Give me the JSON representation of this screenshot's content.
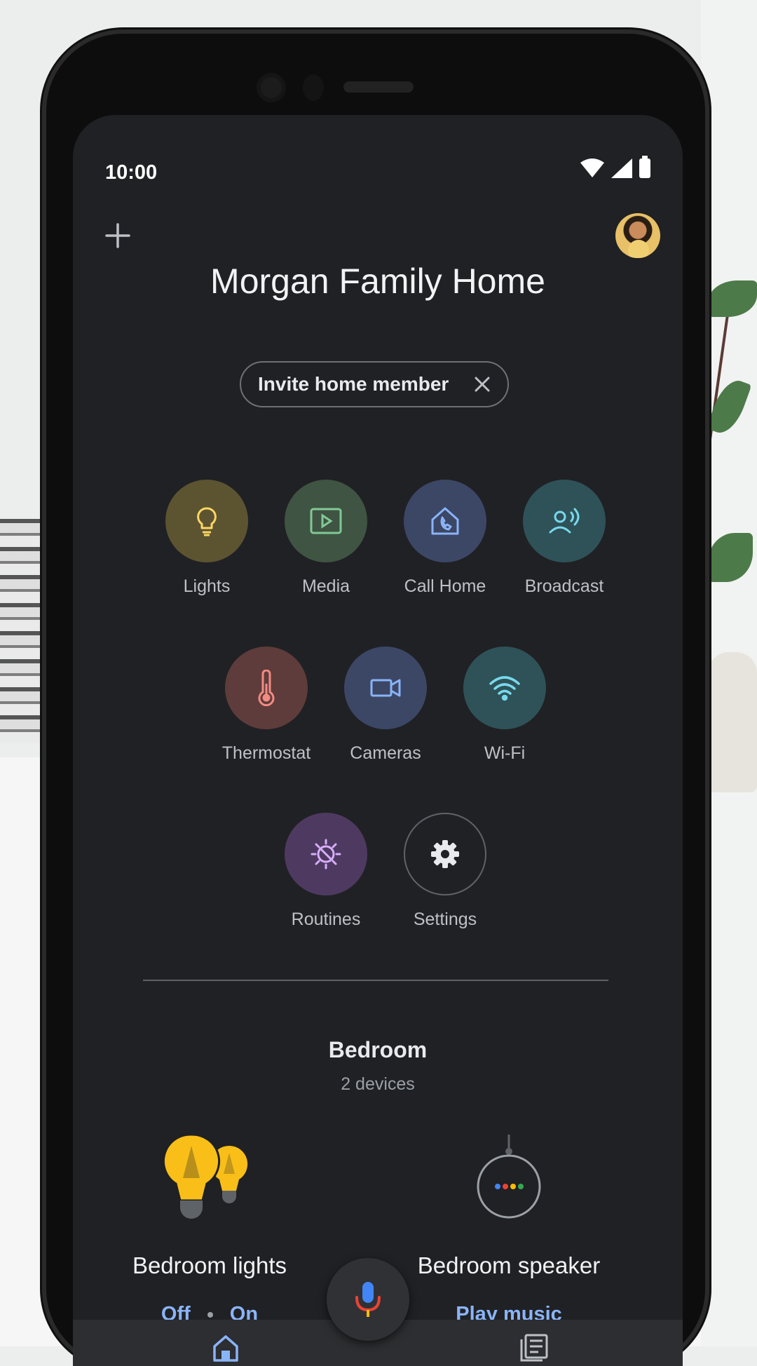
{
  "status_bar": {
    "time": "10:00"
  },
  "header": {
    "home_name": "Morgan Family Home",
    "invite_chip": "Invite home member"
  },
  "shortcuts": [
    {
      "label": "Lights",
      "icon": "lightbulb-icon",
      "color": "#5c5431"
    },
    {
      "label": "Media",
      "icon": "media-icon",
      "color": "#3f5442"
    },
    {
      "label": "Call Home",
      "icon": "call-home-icon",
      "color": "#3c4766"
    },
    {
      "label": "Broadcast",
      "icon": "broadcast-icon",
      "color": "#2e5258"
    },
    {
      "label": "Thermostat",
      "icon": "thermometer-icon",
      "color": "#5e3c3b"
    },
    {
      "label": "Cameras",
      "icon": "camera-icon",
      "color": "#3c4766"
    },
    {
      "label": "Wi-Fi",
      "icon": "wifi-icon",
      "color": "#2e5258"
    },
    {
      "label": "Routines",
      "icon": "routines-icon",
      "color": "#4e3a60"
    },
    {
      "label": "Settings",
      "icon": "gear-icon",
      "color": "#202124"
    }
  ],
  "room": {
    "name": "Bedroom",
    "device_count": "2 devices",
    "devices": [
      {
        "name": "Bedroom lights",
        "icon": "bulbs-icon",
        "actions": [
          "Off",
          "On"
        ]
      },
      {
        "name": "Bedroom speaker",
        "icon": "speaker-icon",
        "actions": [
          "Play music"
        ]
      }
    ]
  },
  "colors": {
    "accent_blue": "#8ab4f8",
    "bulb_yellow": "#f9bf18",
    "background": "#202124"
  }
}
